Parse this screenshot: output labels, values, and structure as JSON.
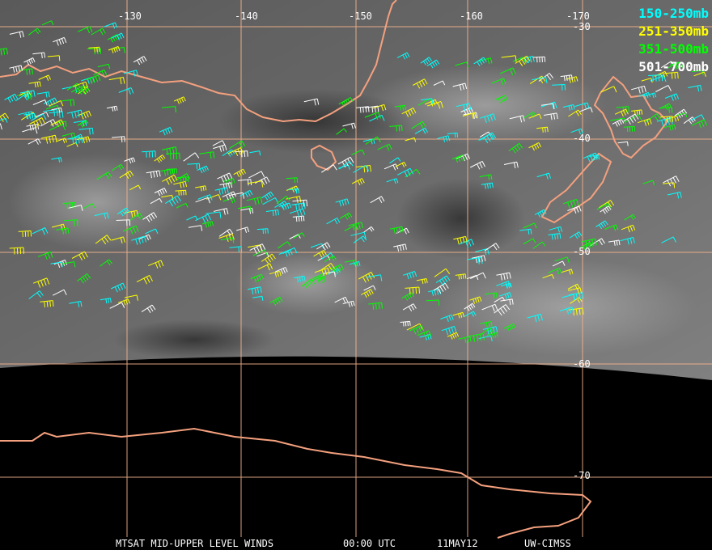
{
  "legend": [
    {
      "label": "150-250mb",
      "color": "#00ffff"
    },
    {
      "label": "251-350mb",
      "color": "#ffff00"
    },
    {
      "label": "351-500mb",
      "color": "#00ff00"
    },
    {
      "label": "501-700mb",
      "color": "#ffffff"
    }
  ],
  "lon_labels": [
    "-130",
    "-140",
    "-150",
    "-160",
    "-170"
  ],
  "lat_labels": [
    "-30",
    "-40",
    "-50",
    "-60",
    "-70"
  ],
  "footer": {
    "product": "MTSAT MID-UPPER LEVEL WINDS",
    "time": "00:00 UTC",
    "date": "11MAY12",
    "source": "UW-CIMSS"
  },
  "colors": {
    "grid": "#f4b38c",
    "coast": "#f4a07e",
    "background": "#000000"
  }
}
